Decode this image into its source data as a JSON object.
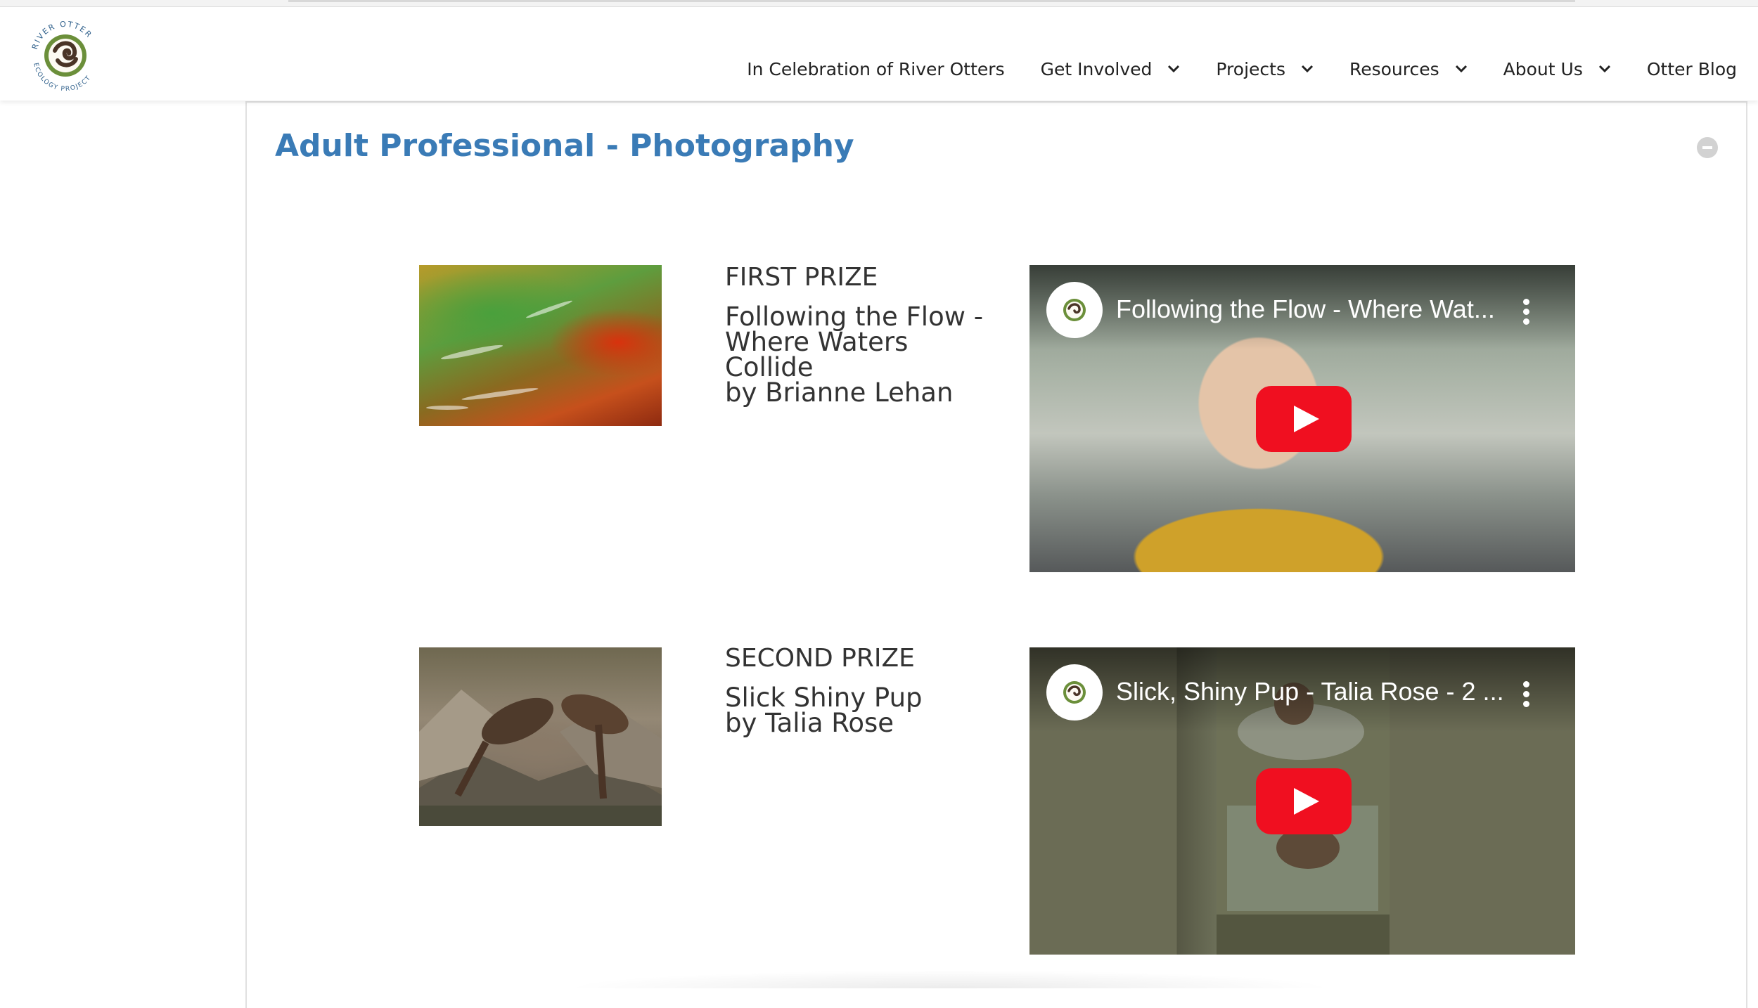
{
  "site": {
    "logo_alt": "River Otter Ecology Project",
    "logo_text_top": "RIVER OTTER",
    "logo_text_bottom": "ECOLOGY PROJECT"
  },
  "nav": {
    "items": [
      {
        "label": "In Celebration of River Otters",
        "dropdown": false
      },
      {
        "label": "Get Involved",
        "dropdown": true
      },
      {
        "label": "Projects",
        "dropdown": true
      },
      {
        "label": "Resources",
        "dropdown": true
      },
      {
        "label": "About Us",
        "dropdown": true
      },
      {
        "label": "Otter Blog",
        "dropdown": false
      }
    ]
  },
  "section": {
    "title": "Adult Professional - Photography"
  },
  "entries": [
    {
      "prize": "FIRST PRIZE",
      "title": "Following the Flow -\nWhere Waters\nCollide\nby Brianne Lehan",
      "video_title": "Following the Flow - Where Wat..."
    },
    {
      "prize": "SECOND PRIZE",
      "title": "Slick Shiny Pup\nby Talia Rose",
      "video_title": "Slick, Shiny Pup - Talia Rose - 2 ..."
    }
  ],
  "colors": {
    "title_blue": "#3a7bb6",
    "play_red": "#f00f20"
  }
}
